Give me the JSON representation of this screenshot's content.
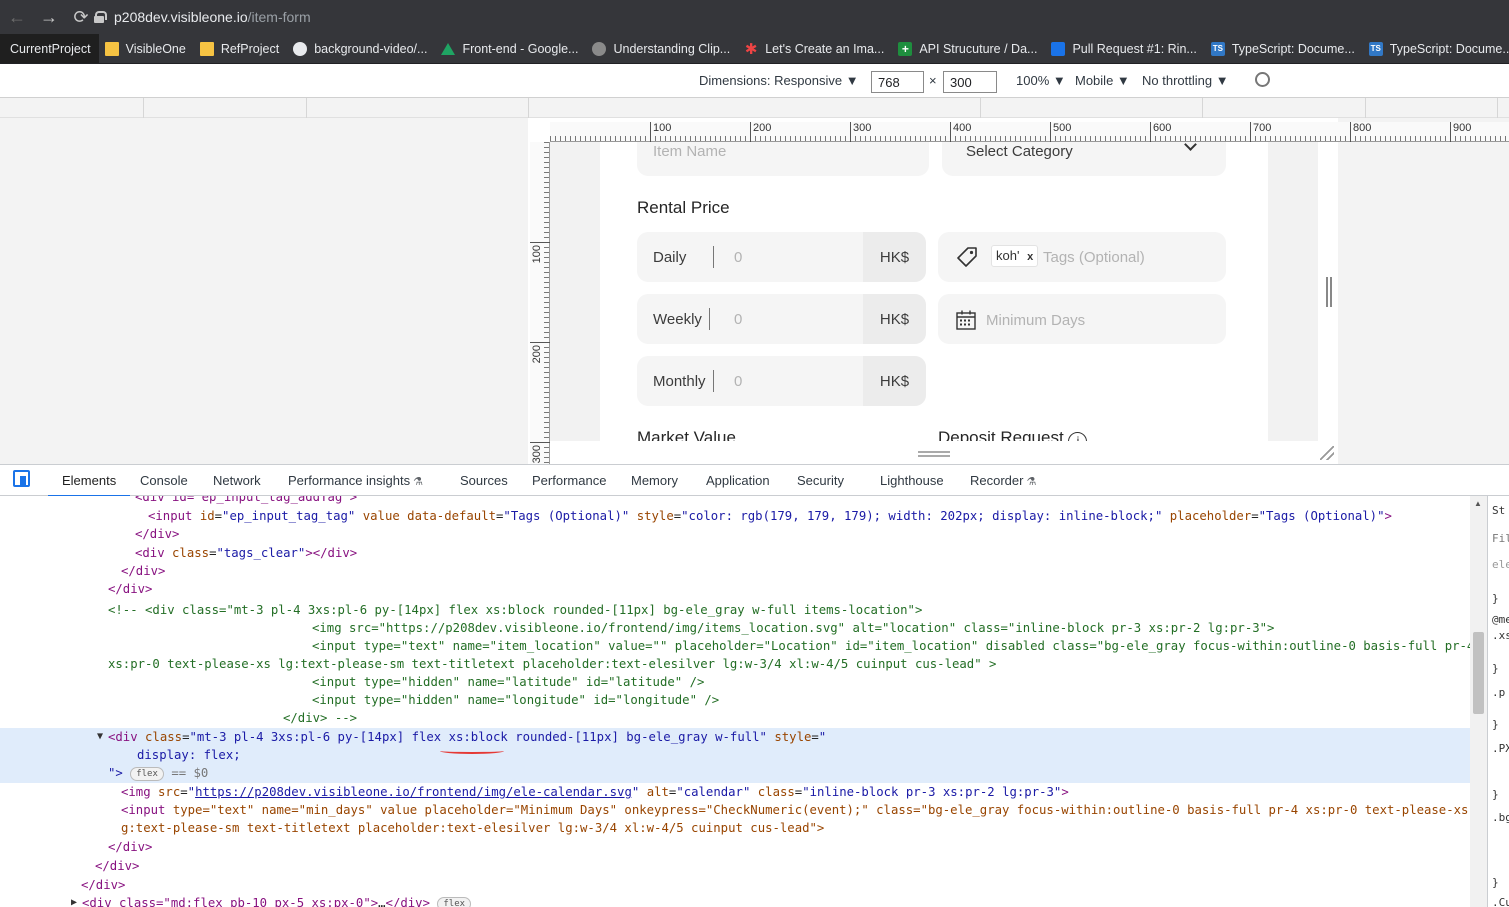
{
  "browser": {
    "url_host": "p208dev.visibleone.io",
    "url_path": "/item-form",
    "bookmarks": [
      {
        "label": "CurrentProject",
        "icon": "folder-icon"
      },
      {
        "label": "VisibleOne",
        "icon": "folder-icon"
      },
      {
        "label": "RefProject",
        "icon": "folder-icon"
      },
      {
        "label": "background-video/...",
        "icon": "github-icon"
      },
      {
        "label": "Front-end - Google...",
        "icon": "drive-icon"
      },
      {
        "label": "Understanding Clip...",
        "icon": "globe-icon"
      },
      {
        "label": "Let's Create an Ima...",
        "icon": "asterisk-icon"
      },
      {
        "label": "API Strucuture / Da...",
        "icon": "plus-icon"
      },
      {
        "label": "Pull Request #1: Rin...",
        "icon": "pr-icon"
      },
      {
        "label": "TypeScript: Docume...",
        "icon": "ts-icon"
      },
      {
        "label": "TypeScript: Docume...",
        "icon": "ts-icon"
      }
    ]
  },
  "device_toolbar": {
    "dimensions": "Dimensions: Responsive",
    "width": "768",
    "times": "×",
    "height": "300",
    "zoom": "100%",
    "device": "Mobile",
    "throttling": "No throttling"
  },
  "rulers": {
    "top": [
      "100",
      "200",
      "300",
      "400",
      "500",
      "600",
      "700",
      "800",
      "900"
    ],
    "left": [
      "100",
      "200",
      "300"
    ]
  },
  "form": {
    "item_name_placeholder": "Item Name",
    "category_placeholder": "Select Category",
    "rental_price_heading": "Rental Price",
    "daily_label": "Daily",
    "weekly_label": "Weekly",
    "monthly_label": "Monthly",
    "price_placeholder": "0",
    "currency": "HK$",
    "tag_chip": "koh'",
    "tag_chip_remove": "x",
    "tags_placeholder": "Tags (Optional)",
    "min_days_placeholder": "Minimum Days",
    "market_value_heading": "Market Value",
    "deposit_heading": "Deposit Request",
    "info_symbol": "i"
  },
  "devtools": {
    "tabs": [
      "Elements",
      "Console",
      "Network",
      "Performance insights",
      "Sources",
      "Performance",
      "Memory",
      "Application",
      "Security",
      "Lighthouse",
      "Recorder"
    ],
    "flask": "⚗",
    "side_lines": [
      "St",
      "Fil",
      "ele",
      "}",
      "@me",
      ".xs",
      "}",
      ".p",
      "}",
      ".PX",
      "}",
      ".bg",
      "}",
      ".Cu"
    ]
  },
  "code": {
    "l0": "<div id=\"ep_input_tag_addTag\">",
    "l1_tag_open": "<input",
    "l1_attrs": [
      {
        "n": "id",
        "v": "ep_input_tag_tag"
      },
      {
        "n": "value",
        "v": null
      },
      {
        "n": "data-default",
        "v": "Tags (Optional)"
      },
      {
        "n": "style",
        "v": "color: rgb(179, 179, 179); width: 202px; display: inline-block;"
      },
      {
        "n": "placeholder",
        "v": "Tags (Optional)"
      }
    ],
    "l2": "</div>",
    "l3_open": "<div",
    "l3_attr_name": "class",
    "l3_attr_val": "tags_clear",
    "l3_close": "></div>",
    "l4": "</div>",
    "l5": "</div>",
    "c1": "<!-- <div class=\"mt-3 pl-4 3xs:pl-6 py-[14px] flex xs:block rounded-[11px] bg-ele_gray w-full items-location\">",
    "c2": "<img src=\"https://p208dev.visibleone.io/frontend/img/items_location.svg\" alt=\"location\" class=\"inline-block pr-3 xs:pr-2 lg:pr-3\">",
    "c3": "<input type=\"text\" name=\"item_location\" value=\"\" placeholder=\"Location\" id=\"item_location\" disabled class=\"bg-ele_gray focus-within:outline-0 basis-full pr-4",
    "c4": "xs:pr-0 text-please-xs lg:text-please-sm text-titletext placeholder:text-elesilver lg:w-3/4 xl:w-4/5 cuinput cus-lead\" >",
    "c5": "<input type=\"hidden\" name=\"latitude\" id=\"latitude\" />",
    "c6": "<input type=\"hidden\" name=\"longitude\" id=\"longitude\" />",
    "c7": "</div> -->",
    "sel_tag": "<div",
    "sel_class_name": "class",
    "sel_class_a": "mt-3 pl-4 3xs:pl-6 py-[14px] flex ",
    "sel_class_b": "xs:block",
    "sel_class_c": " rounded-[11px] bg-ele_gray w-full",
    "sel_style_name": "style",
    "sel_style_open": "\"",
    "sel_style_val": "display: flex;",
    "sel_style_close": "\">",
    "sel_badge": "flex",
    "sel_eq": "== $0",
    "img_tag": "<img",
    "img_src_name": "src",
    "img_src": "https://p208dev.visibleone.io/frontend/img/ele-calendar.svg",
    "img_rest_a_name": "alt",
    "img_rest_a_val": "calendar",
    "img_rest_b_name": "class",
    "img_rest_b_val": "inline-block pr-3 xs:pr-2 lg:pr-3",
    "img_end": ">",
    "inp_a": "<input ",
    "inp_attrs_1": "type=\"text\" name=\"min_days\" value placeholder=\"Minimum Days\" onkeypress=\"CheckNumeric(event);\" class=\"bg-ele_gray focus-within:outline-0 basis-full pr-4 xs:pr-0 text-please-xs l",
    "inp_attrs_2": "g:text-please-sm text-titletext placeholder:text-elesilver lg:w-3/4 xl:w-4/5 cuinput cus-lead\">",
    "e1": "</div>",
    "e2": "</div>",
    "e3": "</div>",
    "last_open": "<div class=\"md:flex pb-10 px-5 xs:px-0\">",
    "last_ell": "…",
    "last_close": "</div>",
    "last_badge": "flex"
  }
}
